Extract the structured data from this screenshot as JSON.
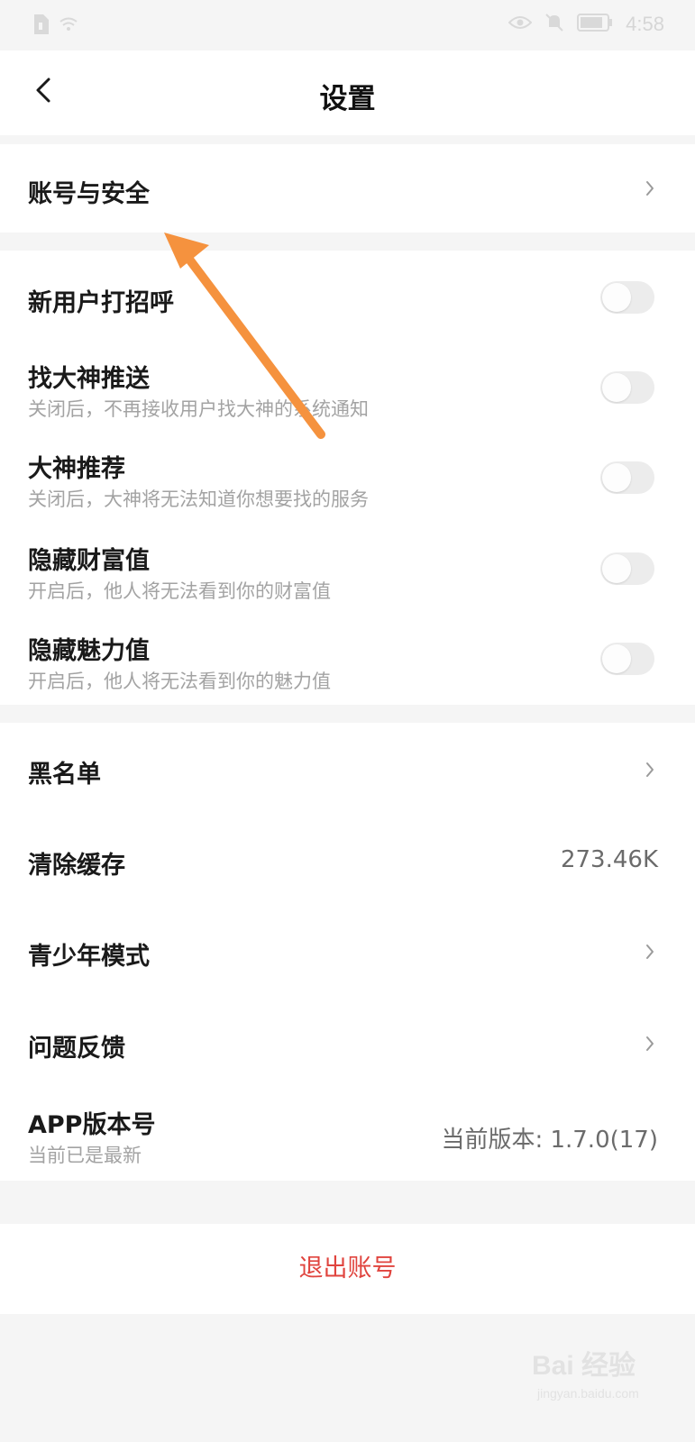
{
  "status_bar": {
    "time": "4:58",
    "icons": [
      "sim-icon",
      "wifi-icon",
      "eye-icon",
      "mute-icon",
      "battery-icon"
    ]
  },
  "nav": {
    "title": "设置",
    "back_icon": "chevron-left-icon"
  },
  "account": {
    "label": "账号与安全"
  },
  "toggles": [
    {
      "title": "新用户打招呼",
      "subtitle": "",
      "on": false
    },
    {
      "title": "找大神推送",
      "subtitle": "关闭后，不再接收用户找大神的系统通知",
      "on": false
    },
    {
      "title": "大神推荐",
      "subtitle": "关闭后，大神将无法知道你想要找的服务",
      "on": false
    },
    {
      "title": "隐藏财富值",
      "subtitle": "开启后，他人将无法看到你的财富值",
      "on": false
    },
    {
      "title": "隐藏魅力值",
      "subtitle": "开启后，他人将无法看到你的魅力值",
      "on": false
    }
  ],
  "misc": {
    "blacklist": "黑名单",
    "clear_cache": "清除缓存",
    "cache_size": "273.46K",
    "youth_mode": "青少年模式",
    "feedback": "问题反馈",
    "version_label": "APP版本号",
    "version_status": "当前已是最新",
    "version_value": "当前版本: 1.7.0(17)"
  },
  "logout": "退出账号",
  "annotation": {
    "color": "#f5923e"
  },
  "watermark": {
    "main": "Bai 经验",
    "sub": "jingyan.baidu.com"
  }
}
